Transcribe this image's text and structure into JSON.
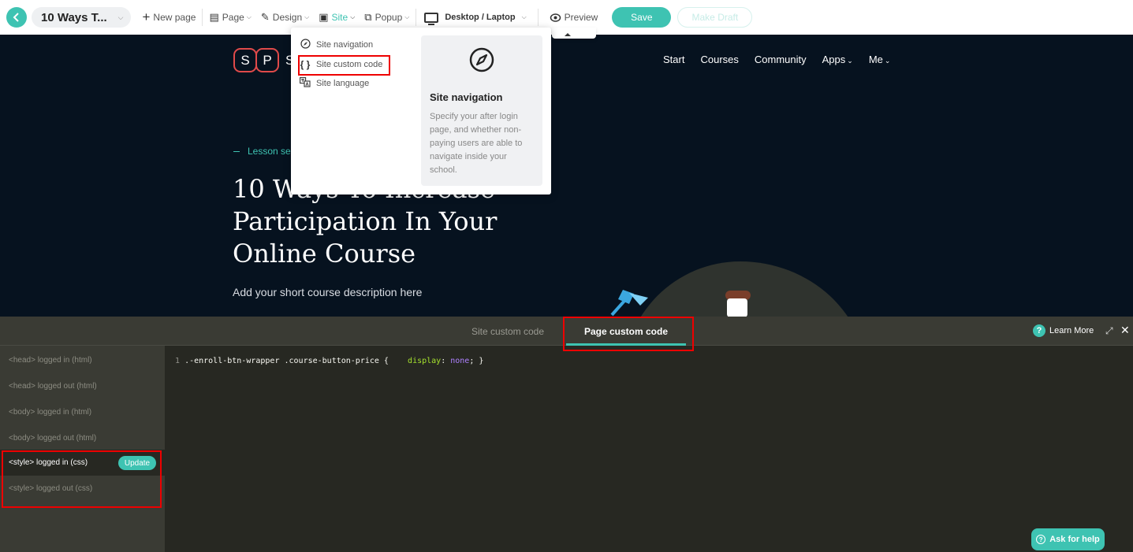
{
  "toolbar": {
    "page_title": "10 Ways T...",
    "new_page": "New page",
    "page": "Page",
    "design": "Design",
    "site": "Site",
    "popup": "Popup",
    "device": "Desktop / Laptop",
    "preview": "Preview",
    "save": "Save",
    "make_draft": "Make Draft"
  },
  "site_menu": {
    "items": [
      {
        "label": "Site navigation",
        "icon": "compass-icon"
      },
      {
        "label": "Site custom code",
        "icon": "braces-icon"
      },
      {
        "label": "Site language",
        "icon": "translate-icon"
      }
    ],
    "info": {
      "title": "Site navigation",
      "description": "Specify your after login page, and whether non-paying users are able to navigate inside your school."
    }
  },
  "canvas": {
    "logo_letters": [
      "S",
      "P"
    ],
    "logo_rest": "S",
    "nav": [
      "Start",
      "Courses",
      "Community",
      "Apps",
      "Me"
    ],
    "lesson_label": "Lesson se",
    "title": "10 Ways To Increase Participation In Your Online Course",
    "description": "Add your short course description here"
  },
  "code_panel": {
    "tabs": [
      "Site custom code",
      "Page custom code"
    ],
    "active_tab": "Page custom code",
    "learn_more": "Learn More",
    "sidebar": [
      "<head> logged in (html)",
      "<head> logged out (html)",
      "<body> logged in (html)",
      "<body> logged out (html)",
      "<style> logged in (css)",
      "<style> logged out (css)"
    ],
    "update_label": "Update",
    "code": {
      "line_no": "1",
      "selector": ".-enroll-btn-wrapper .course-button-price {",
      "property": "display",
      "value": "none",
      "closing": "}"
    },
    "ask_help": "Ask for help"
  },
  "colors": {
    "accent": "#3ec3b2",
    "canvas_bg": "#06121f",
    "editor_bg": "#272822",
    "highlight": "#e00000"
  }
}
